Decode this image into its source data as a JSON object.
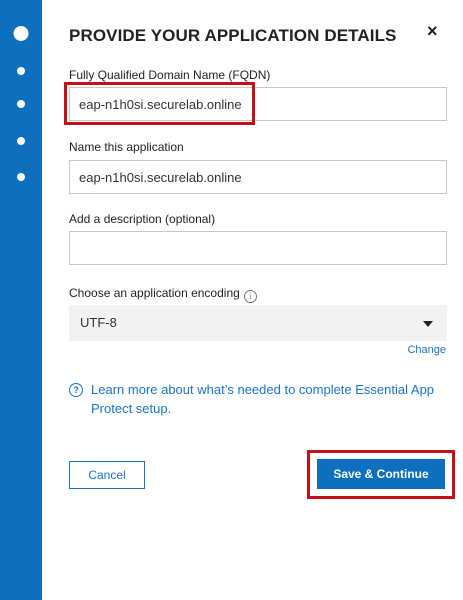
{
  "dialog": {
    "title": "PROVIDE YOUR APPLICATION DETAILS",
    "close_icon": "×"
  },
  "stepper": {
    "steps": [
      "current",
      "pending",
      "pending",
      "pending",
      "pending"
    ]
  },
  "fields": {
    "fqdn": {
      "label": "Fully Qualified Domain Name (FQDN)",
      "value": "eap-n1h0si.securelab.online"
    },
    "app_name": {
      "label": "Name this application",
      "value": "eap-n1h0si.securelab.online"
    },
    "description": {
      "label": "Add a description (optional)",
      "value": ""
    },
    "encoding": {
      "label": "Choose an application encoding",
      "selected": "UTF-8",
      "change_link": "Change"
    }
  },
  "help": {
    "text": "Learn more about what’s needed to complete Essential App Protect setup.",
    "icon": "question-circle-icon"
  },
  "actions": {
    "cancel_label": "Cancel",
    "save_label": "Save & Continue"
  },
  "colors": {
    "primary": "#0f6fbf",
    "link": "#1a73c7",
    "highlight": "#c80f18"
  }
}
